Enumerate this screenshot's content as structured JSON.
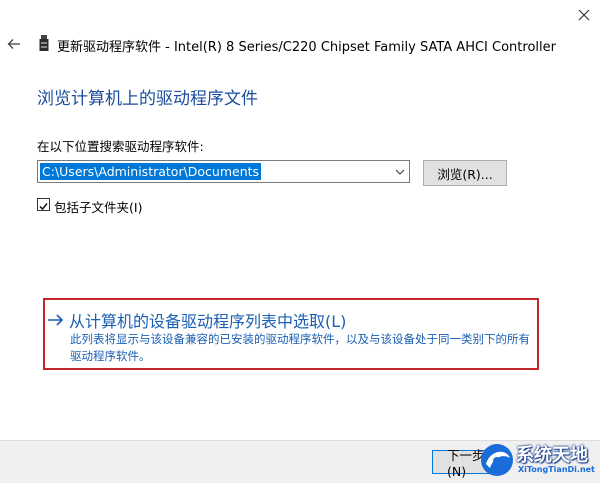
{
  "window": {
    "title": "更新驱动程序软件 - Intel(R) 8 Series/C220 Chipset Family SATA AHCI Controller",
    "close_icon": "close-icon",
    "back_icon": "back-arrow-icon"
  },
  "main": {
    "heading": "浏览计算机上的驱动程序文件",
    "search_label": "在以下位置搜索驱动程序软件:",
    "path_value": "C:\\Users\\Administrator\\Documents",
    "browse_label": "浏览(R)...",
    "include_subfolders_label": "包括子文件夹(I)",
    "include_subfolders_checked": true
  },
  "pick_option": {
    "title": "从计算机的设备驱动程序列表中选取(L)",
    "description": "此列表将显示与该设备兼容的已安装的驱动程序软件，以及与该设备处于同一类别下的所有驱动程序软件。"
  },
  "footer": {
    "next_label": "下一步(N)"
  },
  "watermark": {
    "name": "系统天地",
    "url": "XiTongTianDi.net"
  },
  "colors": {
    "heading": "#1a4d9c",
    "link": "#1a5fb4",
    "highlight_box": "#c3272b",
    "selection": "#0078d7"
  }
}
